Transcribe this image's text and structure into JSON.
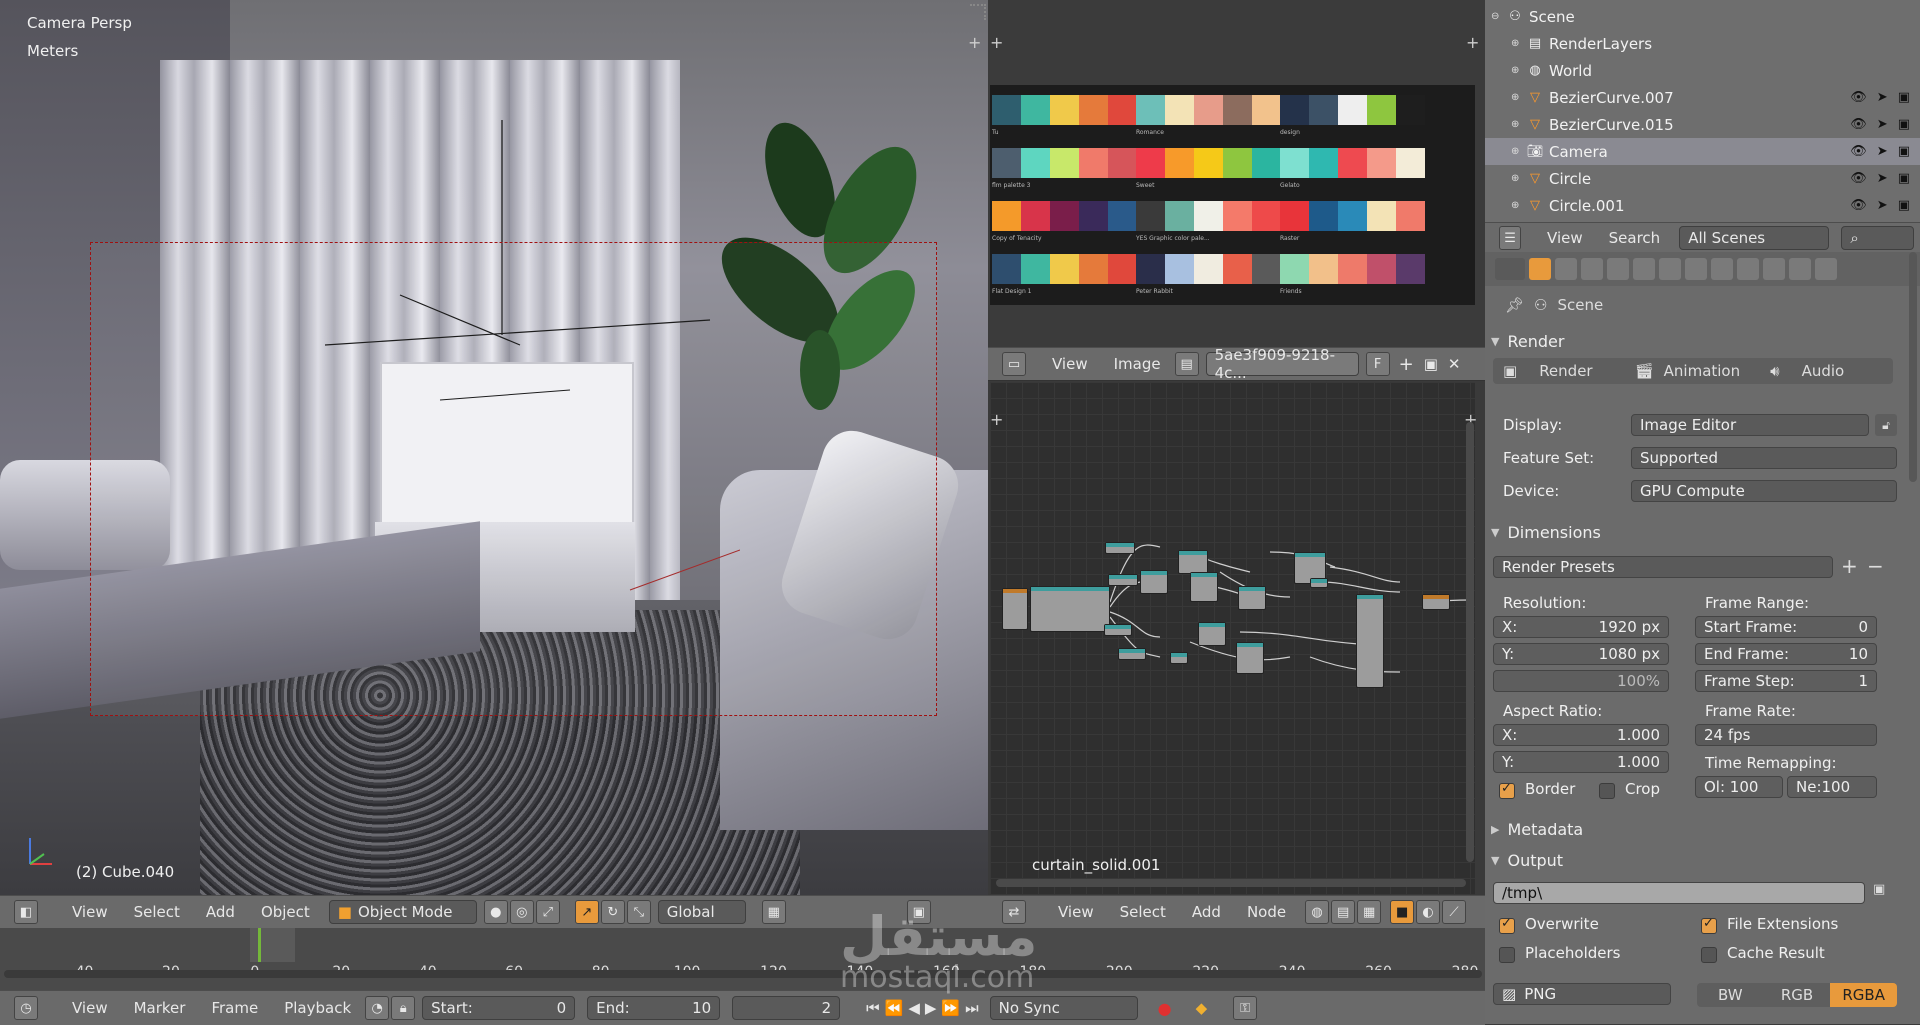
{
  "viewport": {
    "camera_label": "Camera Persp",
    "units_label": "Meters",
    "object_label": "(2) Cube.040",
    "header": {
      "menus": [
        "View",
        "Select",
        "Add",
        "Object"
      ],
      "mode": "Object Mode",
      "orientation": "Global"
    }
  },
  "image_editor": {
    "palettes": [
      {
        "name": "Tu",
        "colors": [
          "#2e5e6e",
          "#3fb7a0",
          "#f0c94a",
          "#e57a3b",
          "#e0483c"
        ]
      },
      {
        "name": "Romance",
        "colors": [
          "#6dbfb8",
          "#f3e3b6",
          "#e79c8a",
          "#8c6c5e",
          "#f2c28c"
        ]
      },
      {
        "name": "design",
        "colors": [
          "#24324a",
          "#3c5166",
          "#eeeeee",
          "#8ec63f",
          "#1e1e1e"
        ]
      },
      {
        "name": "flm palette 3",
        "colors": [
          "#4d5e6e",
          "#5ed6c0",
          "#c8e86a",
          "#f07a6a",
          "#d6555a"
        ]
      },
      {
        "name": "Sweet",
        "colors": [
          "#ee3b4a",
          "#f79a2a",
          "#f5c918",
          "#8ec63f",
          "#2bb5a0"
        ]
      },
      {
        "name": "Gelato",
        "colors": [
          "#7ee0d0",
          "#2fb8b0",
          "#ee4a50",
          "#f49a8a",
          "#f3ecd8"
        ]
      },
      {
        "name": "Copy of Tenacity",
        "colors": [
          "#f49a2a",
          "#d8344a",
          "#7a1e4a",
          "#3a2a5a",
          "#2a5a8a"
        ]
      },
      {
        "name": "YES Graphic color pale...",
        "colors": [
          "#3a3a3a",
          "#6ab0a0",
          "#f0f0e8",
          "#f47a6a",
          "#ee4a4a"
        ]
      },
      {
        "name": "Raster",
        "colors": [
          "#e8343a",
          "#1e5a8a",
          "#2a8ab8",
          "#f3e3b6",
          "#f07a6a"
        ]
      },
      {
        "name": "Flat Design 1",
        "colors": [
          "#2e4e6e",
          "#3fb7a0",
          "#f0c94a",
          "#e57a3b",
          "#e0483c"
        ]
      },
      {
        "name": "Peter Rabbit",
        "colors": [
          "#2a2e4a",
          "#a8c0e0",
          "#f0ece0",
          "#e8604a",
          "#5a5a5a"
        ]
      },
      {
        "name": "Friends",
        "colors": [
          "#8ed8b0",
          "#f2c08a",
          "#ee7a6a",
          "#c0506a",
          "#5a3a6a"
        ]
      }
    ],
    "header": {
      "menus": [
        "View",
        "Image"
      ],
      "image_name": "5ae3f909-9218-4c...",
      "fake_user": "F"
    }
  },
  "node_editor": {
    "material_name": "curtain_solid.001",
    "header": {
      "menus": [
        "View",
        "Select",
        "Add",
        "Node"
      ]
    }
  },
  "outliner": {
    "rows": [
      {
        "label": "Scene",
        "icon": "scene-icon"
      },
      {
        "label": "RenderLayers",
        "icon": "render-layers-icon"
      },
      {
        "label": "World",
        "icon": "world-icon"
      },
      {
        "label": "BezierCurve.007",
        "icon": "curve-icon"
      },
      {
        "label": "BezierCurve.015",
        "icon": "curve-icon"
      },
      {
        "label": "Camera",
        "icon": "camera-icon"
      },
      {
        "label": "Circle",
        "icon": "curve-icon"
      },
      {
        "label": "Circle.001",
        "icon": "curve-icon"
      }
    ],
    "header": {
      "menus": [
        "View",
        "Search"
      ],
      "scenes": "All Scenes"
    }
  },
  "properties": {
    "context": "Scene",
    "render": {
      "title": "Render",
      "buttons": [
        "Render",
        "Animation",
        "Audio"
      ],
      "display_label": "Display:",
      "display_value": "Image Editor",
      "feature_set_label": "Feature Set:",
      "feature_set_value": "Supported",
      "device_label": "Device:",
      "device_value": "GPU Compute"
    },
    "dimensions": {
      "title": "Dimensions",
      "presets": "Render Presets",
      "resolution_label": "Resolution:",
      "res_x_label": "X:",
      "res_x": "1920 px",
      "res_y_label": "Y:",
      "res_y": "1080 px",
      "res_pct": "100%",
      "aspect_label": "Aspect Ratio:",
      "aspect_x_label": "X:",
      "aspect_x": "1.000",
      "aspect_y_label": "Y:",
      "aspect_y": "1.000",
      "border_label": "Border",
      "crop_label": "Crop",
      "frame_range_label": "Frame Range:",
      "start_label": "Start Frame:",
      "start_value": "0",
      "end_label": "End Frame:",
      "end_value": "10",
      "step_label": "Frame Step:",
      "step_value": "1",
      "frame_rate_label": "Frame Rate:",
      "frame_rate_value": "24 fps",
      "time_remap_label": "Time Remapping:",
      "old_value": "Ol: 100",
      "new_value": "Ne:100"
    },
    "metadata_title": "Metadata",
    "output": {
      "title": "Output",
      "path": "/tmp\\",
      "overwrite": "Overwrite",
      "file_extensions": "File Extensions",
      "placeholders": "Placeholders",
      "cache_result": "Cache Result",
      "format": "PNG",
      "color_modes": [
        "BW",
        "RGB",
        "RGBA"
      ]
    }
  },
  "timeline": {
    "ticks": [
      "-40",
      "-20",
      "0",
      "20",
      "40",
      "60",
      "80",
      "100",
      "120",
      "140",
      "160",
      "180",
      "200",
      "220",
      "240",
      "260",
      "280"
    ],
    "menus": [
      "View",
      "Marker",
      "Frame",
      "Playback"
    ],
    "start_label": "Start:",
    "start_value": "0",
    "end_label": "End:",
    "end_value": "10",
    "current_frame": "2",
    "sync": "No Sync"
  },
  "watermark": {
    "arabic": "مستقل",
    "latin": "mostaql.com"
  }
}
